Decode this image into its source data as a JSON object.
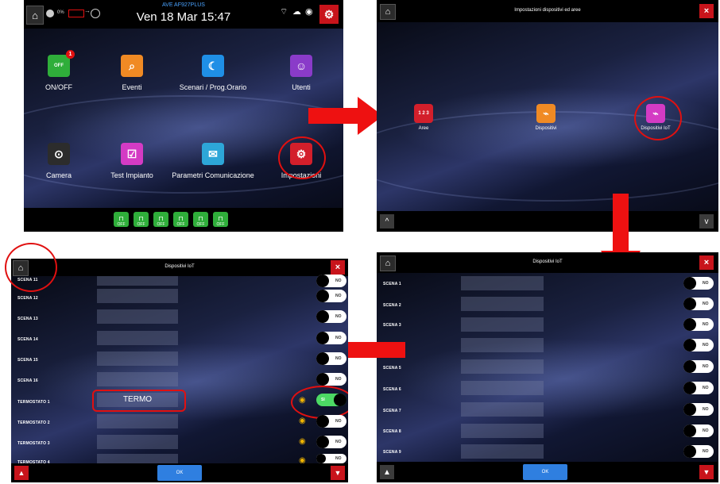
{
  "panel1": {
    "device_name": "AVE AF927PLUS",
    "datetime": "Ven 18 Mar 15:47",
    "status_pct": "0%",
    "tiles": [
      {
        "label": "ON/OFF",
        "badge": "1"
      },
      {
        "label": "Eventi"
      },
      {
        "label": "Scenari / Prog.Orario"
      },
      {
        "label": "Utenti"
      },
      {
        "label": "Camera"
      },
      {
        "label": "Test Impianto"
      },
      {
        "label": "Parametri Comunicazione"
      },
      {
        "label": "Impostazioni"
      }
    ],
    "lock_label": "OFF",
    "lock_buttons": [
      "1",
      "2",
      "3",
      "4",
      "5",
      "6"
    ]
  },
  "panel2": {
    "title": "Impostazioni dispositivi ed aree",
    "tiles": [
      {
        "label": "Aree"
      },
      {
        "label": "Dispositivi"
      },
      {
        "label": "Dispositivi IoT"
      }
    ],
    "close": "×",
    "up": "^",
    "down": "v"
  },
  "panel3": {
    "title": "Dispositivi IoT",
    "close": "×",
    "rows": [
      "SCENA 1",
      "SCENA 2",
      "SCENA 3",
      "",
      "SCENA 5",
      "SCENA 6",
      "SCENA 7",
      "SCENA 8",
      "SCENA 9"
    ],
    "toggle_label": "NO",
    "ok": "OK"
  },
  "panel4": {
    "title": "Dispositivi IoT",
    "close": "×",
    "rows": [
      {
        "label": "SCENA 11",
        "value": "",
        "state": "NO"
      },
      {
        "label": "SCENA 12",
        "value": "",
        "state": "NO"
      },
      {
        "label": "SCENA 13",
        "value": "",
        "state": "NO"
      },
      {
        "label": "SCENA 14",
        "value": "",
        "state": "NO"
      },
      {
        "label": "SCENA 15",
        "value": "",
        "state": "NO"
      },
      {
        "label": "SCENA 16",
        "value": "",
        "state": "NO"
      },
      {
        "label": "TERMOSTATO 1",
        "value": "TERMO",
        "state": "SI"
      },
      {
        "label": "TERMOSTATO 2",
        "value": "",
        "state": "NO"
      },
      {
        "label": "TERMOSTATO 3",
        "value": "",
        "state": "NO"
      },
      {
        "label": "TERMOSTATO 4",
        "value": "",
        "state": "NO"
      }
    ],
    "ok": "OK"
  },
  "colors": {
    "accent_red": "#e01010",
    "close_red": "#c8141b",
    "ok_blue": "#2f7fe0",
    "toggle_on": "#4cd964"
  }
}
